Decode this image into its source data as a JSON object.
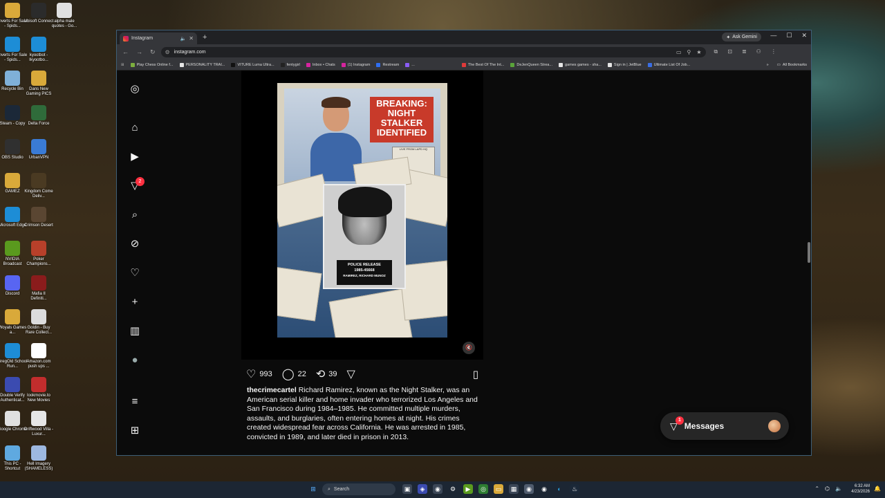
{
  "desktop": {
    "icons": [
      {
        "label": "Inverts For Sale - Spids...",
        "icon": "folder-icon",
        "color": "#d9a93a"
      },
      {
        "label": "Ubisoft Connect",
        "icon": "ubisoft-icon",
        "color": "#2b2b2b"
      },
      {
        "label": "alpha male quotes - Go...",
        "icon": "chrome-shortcut-icon",
        "color": "#e0e0e0"
      },
      {
        "label": "Inverts For Sale - Spids...",
        "icon": "edge-shortcut-icon",
        "color": "#1d8dd6"
      },
      {
        "label": "kyootbot - Ikyootbo...",
        "icon": "edge-shortcut-icon",
        "color": "#1d8dd6"
      },
      {
        "label": "Recycle Bin",
        "icon": "recycle-bin-icon",
        "color": "#7fb0d8"
      },
      {
        "label": "Dans New Gaming PICS",
        "icon": "folder-icon",
        "color": "#d9a93a"
      },
      {
        "label": "Steam - Copy",
        "icon": "steam-icon",
        "color": "#1b2838"
      },
      {
        "label": "Delta Force",
        "icon": "delta-force-icon",
        "color": "#2f6b3a"
      },
      {
        "label": "OBS Studio",
        "icon": "obs-icon",
        "color": "#303030"
      },
      {
        "label": "UrbanVPN",
        "icon": "urbanvpn-icon",
        "color": "#3a7bd5"
      },
      {
        "label": "GAMEZ",
        "icon": "folder-icon",
        "color": "#d9a93a"
      },
      {
        "label": "Kingdom Come Deliv...",
        "icon": "kingdom-come-icon",
        "color": "#4a3a22"
      },
      {
        "label": "Microsoft Edge",
        "icon": "edge-icon",
        "color": "#1d8dd6"
      },
      {
        "label": "Crimson Desert",
        "icon": "crimson-desert-icon",
        "color": "#5a4632"
      },
      {
        "label": "NVIDIA Broadcast",
        "icon": "nvidia-icon",
        "color": "#5a9a1e"
      },
      {
        "label": "Poker Champions...",
        "icon": "poker-icon",
        "color": "#b8402a"
      },
      {
        "label": "Discord",
        "icon": "discord-icon",
        "color": "#5865f2"
      },
      {
        "label": "Mafia II Definiti...",
        "icon": "mafia-icon",
        "color": "#8a1c1c"
      },
      {
        "label": "Woyals Games a...",
        "icon": "folder-icon",
        "color": "#d9a93a"
      },
      {
        "label": "Goldin - Buy Rare Collect...",
        "icon": "goldin-icon",
        "color": "#dcdcdc"
      },
      {
        "label": "GregOld School Run...",
        "icon": "edge-shortcut-icon",
        "color": "#1d8dd6"
      },
      {
        "label": "Amazon.com push ups ...",
        "icon": "amazon-icon",
        "color": "#ffffff"
      },
      {
        "label": "Double Verify Authenticat...",
        "icon": "doubleverify-icon",
        "color": "#3b4bb0"
      },
      {
        "label": "lookmovie.to New Movies",
        "icon": "lookmovie-icon",
        "color": "#c22d2d"
      },
      {
        "label": "Google Chrome",
        "icon": "chrome-icon",
        "color": "#e0e0e0"
      },
      {
        "label": "Driftwood Villa - Luxur...",
        "icon": "document-icon",
        "color": "#e6e6e6"
      },
      {
        "label": "This PC - Shortcut",
        "icon": "this-pc-icon",
        "color": "#5fa9e0"
      },
      {
        "label": "Hell Imagery (SHAMELESS)",
        "icon": "image-icon",
        "color": "#9db8e0"
      }
    ]
  },
  "browser": {
    "tab_title": "Instagram",
    "new_tab": "+",
    "ask_gemini": "Ask Gemini",
    "url": "instagram.com",
    "bookmarks": [
      {
        "label": "Play Chess Online f...",
        "color": "#7cae3e"
      },
      {
        "label": "PERSONALITY TRAI...",
        "color": "#e5e5e5"
      },
      {
        "label": "VITURE Luma Ultra...",
        "color": "#111111"
      },
      {
        "label": "fentygirl",
        "color": "#222222"
      },
      {
        "label": "Inbox • Chats",
        "color": "#d6249f"
      },
      {
        "label": "(1) Instagram",
        "color": "#d6249f"
      },
      {
        "label": "Restream",
        "color": "#2f6ef0"
      },
      {
        "label": "...",
        "color": "#8a5cf5"
      },
      {
        "label": "The Best Of The Int...",
        "color": "#e03a3a"
      },
      {
        "label": "DeJenQueen Strea...",
        "color": "#5aa33a"
      },
      {
        "label": "games games - sha...",
        "color": "#e5e5e5"
      },
      {
        "label": "Sign in | JetBlue",
        "color": "#e5e5e5"
      },
      {
        "label": "Ultimate List Of Job...",
        "color": "#3a6ee5"
      }
    ],
    "all_bookmarks": "All Bookmarks"
  },
  "instagram": {
    "nav": [
      {
        "name": "instagram-logo-icon",
        "glyph": "◎"
      },
      {
        "name": "home-icon",
        "glyph": "⌂"
      },
      {
        "name": "reels-icon",
        "glyph": "▶"
      },
      {
        "name": "direct-icon",
        "glyph": "▽"
      },
      {
        "name": "search-icon",
        "glyph": "⌕"
      },
      {
        "name": "explore-icon",
        "glyph": "⊘"
      },
      {
        "name": "notifications-icon",
        "glyph": "♡"
      },
      {
        "name": "create-icon",
        "glyph": "+"
      },
      {
        "name": "dashboard-icon",
        "glyph": "▥"
      },
      {
        "name": "profile-avatar",
        "glyph": "●"
      },
      {
        "name": "menu-icon",
        "glyph": "≡"
      },
      {
        "name": "more-apps-icon",
        "glyph": "⊞"
      }
    ],
    "direct_badge": "2",
    "post_image": {
      "headline": "BREAKING: NIGHT STALKER IDENTIFIED",
      "live_text": "LIVE FROM LAPD HQ",
      "plate_line1": "POLICE RELEASE",
      "plate_line2": "1985-45668",
      "plate_line3": "RAMIREZ, RICHARD MUNOZ"
    },
    "likes": "993",
    "comments": "22",
    "reposts": "39",
    "username": "thecrimecartel",
    "caption": "Richard Ramirez, known as the Night Stalker, was an American serial killer and home invader who terrorized Los Angeles and San Francisco during 1984–1985. He committed multiple murders, assaults, and burglaries, often entering homes at night. His crimes created widespread fear across California. He was arrested in 1985, convicted in 1989, and later died in prison in 2013.",
    "messages_label": "Messages",
    "messages_badge": "1"
  },
  "taskbar": {
    "search_placeholder": "Search",
    "time": "6:32 AM",
    "date": "4/23/2026"
  }
}
